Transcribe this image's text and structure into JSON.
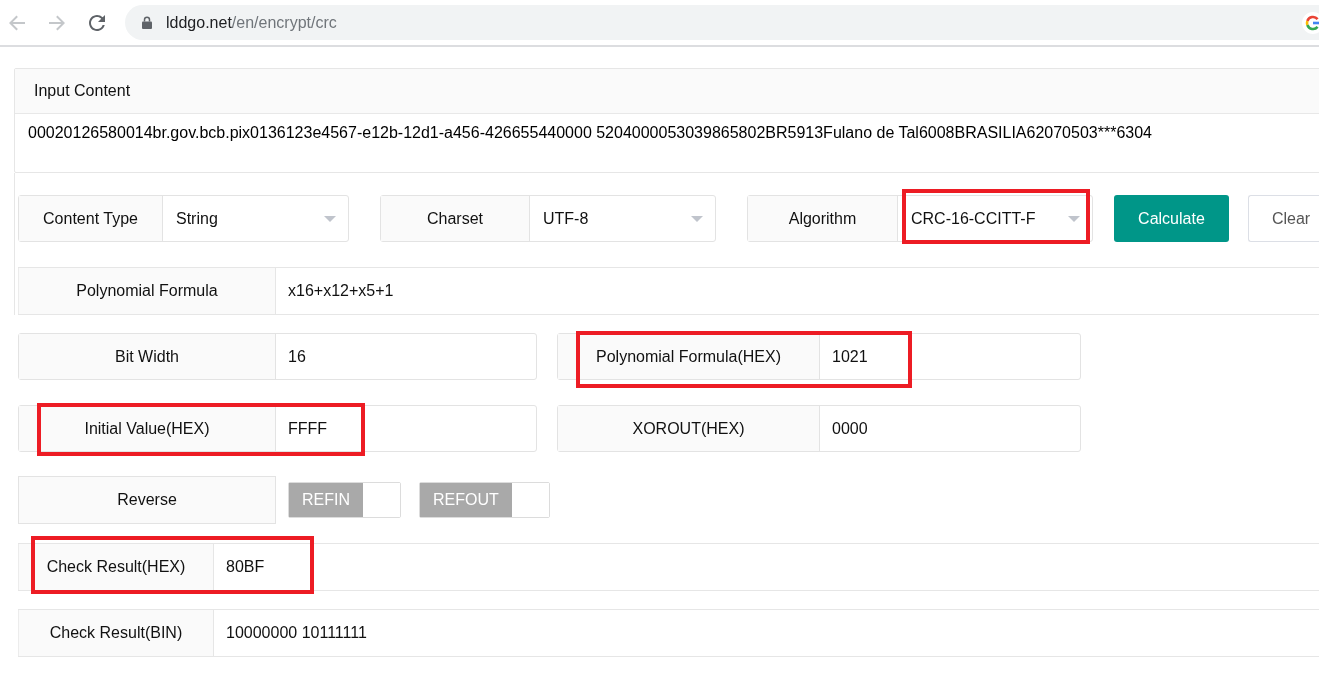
{
  "browser": {
    "url_host": "lddgo.net",
    "url_path": "/en/encrypt/crc"
  },
  "input_section": {
    "title": "Input Content",
    "value": "00020126580014br.gov.bcb.pix0136123e4567-e12b-12d1-a456-426655440000 5204000053039865802BR5913Fulano de Tal6008BRASILIA62070503***6304"
  },
  "options": [
    {
      "label": "Content Type",
      "value": "String",
      "highlighted": false
    },
    {
      "label": "Charset",
      "value": "UTF-8",
      "highlighted": false
    },
    {
      "label": "Algorithm",
      "value": "CRC-16-CCITT-F",
      "highlighted": true
    }
  ],
  "buttons": [
    {
      "label": "Calculate",
      "kind": "primary"
    },
    {
      "label": "Clear",
      "kind": "default"
    }
  ],
  "formula": {
    "label": "Polynomial Formula",
    "value": "x16+x12+x5+1"
  },
  "parameter_rows": [
    [
      {
        "label": "Bit Width",
        "value": "16",
        "highlighted": false
      },
      {
        "label": "Polynomial Formula(HEX)",
        "value": "1021",
        "highlighted": true
      }
    ],
    [
      {
        "label": "Initial Value(HEX)",
        "value": "FFFF",
        "highlighted": true
      },
      {
        "label": "XOROUT(HEX)",
        "value": "0000",
        "highlighted": false
      }
    ]
  ],
  "reverse": {
    "label": "Reverse",
    "switches": [
      {
        "label": "REFIN",
        "on": false
      },
      {
        "label": "REFOUT",
        "on": false
      }
    ]
  },
  "results": [
    {
      "label": "Check Result(HEX)",
      "value": "80BF",
      "highlighted": true
    },
    {
      "label": "Check Result(BIN)",
      "value": "10000000 10111111",
      "highlighted": false
    }
  ]
}
